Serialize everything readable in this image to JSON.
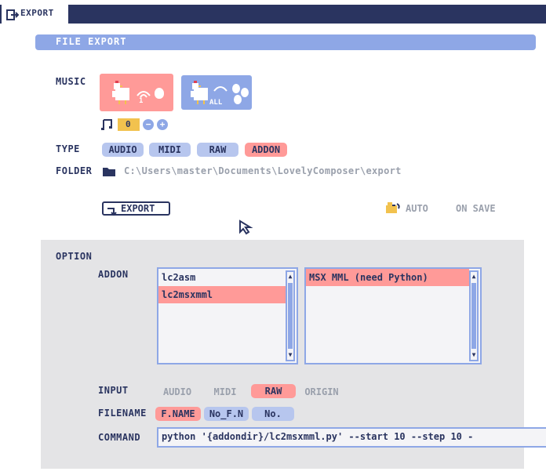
{
  "tab": {
    "label": "EXPORT",
    "icon": "export-icon"
  },
  "section": {
    "title": "FILE EXPORT"
  },
  "music": {
    "label": "MUSIC",
    "buttons": [
      {
        "name": "single-song-chicken",
        "caption": "1",
        "color": "#ff9a98"
      },
      {
        "name": "all-songs-chicken",
        "caption": "ALL",
        "color": "#8ea7e6"
      }
    ],
    "song_number": "0",
    "minus": "−",
    "plus": "+"
  },
  "type": {
    "label": "TYPE",
    "options": [
      "AUDIO",
      "MIDI",
      "RAW",
      "ADDON"
    ],
    "selected": "ADDON"
  },
  "folder": {
    "label": "FOLDER",
    "path": "C:\\Users\\master\\Documents\\LovelyComposer\\export"
  },
  "actions": {
    "export": "EXPORT",
    "auto": "AUTO",
    "on_save": "ON SAVE"
  },
  "option": {
    "label": "OPTION",
    "addon_label": "ADDON",
    "addon_list": [
      "lc2asm",
      "lc2msxmml"
    ],
    "addon_selected": "lc2msxmml",
    "format_list": [
      "MSX MML (need Python)"
    ],
    "input_label": "INPUT",
    "input_options": [
      "AUDIO",
      "MIDI",
      "RAW",
      "ORIGIN"
    ],
    "input_selected": "RAW",
    "filename_label": "FILENAME",
    "filename_options": [
      "F.NAME",
      "No_F.N",
      "No."
    ],
    "filename_selected": "F.NAME",
    "command_label": "COMMAND",
    "command_value": "python '{addondir}/lc2msxmml.py' --start 10 --step 10 -"
  },
  "colors": {
    "navy": "#2a3460",
    "accent_blue": "#8ea7e6",
    "pill_blue": "#b7c6ee",
    "accent_red": "#ff9a98",
    "panel_gray": "#e4e4e6",
    "note_yellow": "#f2c24e"
  }
}
